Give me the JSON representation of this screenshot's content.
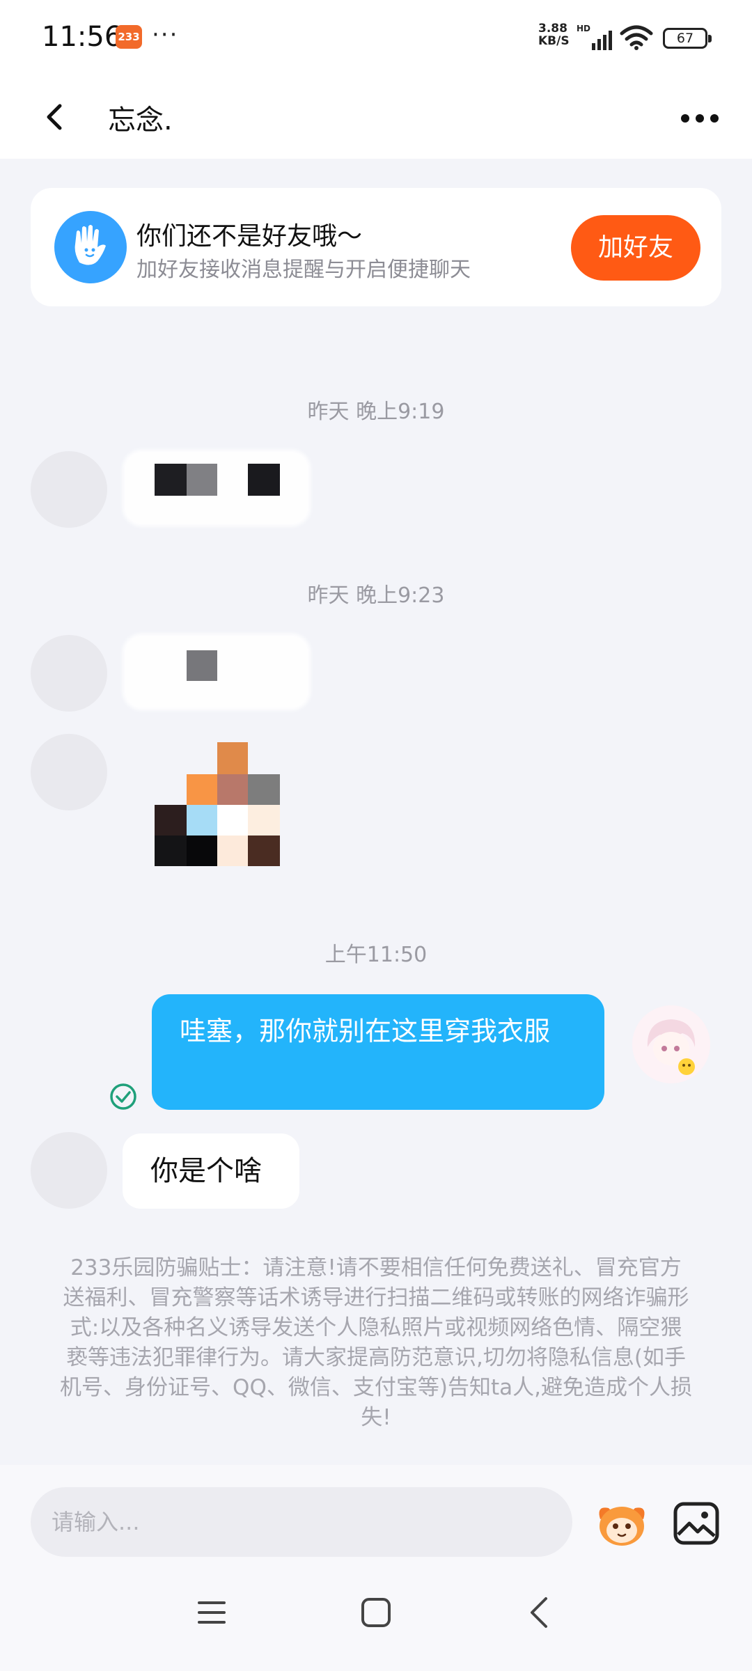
{
  "status_bar": {
    "time": "11:56",
    "app_badge": "233",
    "dots": "···",
    "net_speed_value": "3.88",
    "net_speed_unit": "KB/S",
    "hd": "HD",
    "battery": "67"
  },
  "header": {
    "title": "忘念."
  },
  "friend_banner": {
    "title": "你们还不是好友哦～",
    "subtitle": "加好友接收消息提醒与开启便捷聊天",
    "button_label": "加好友",
    "accent_color": "#ff5a14"
  },
  "messages": {
    "timestamp_1": "昨天 晚上9:19",
    "timestamp_2": "昨天 晚上9:23",
    "timestamp_3": "上午11:50",
    "outgoing_text": "哇塞，那你就别在这里穿我衣服",
    "incoming_text": "你是个啥",
    "outgoing_color": "#23b4fb"
  },
  "safety_tip": "233乐园防骗贴士：请注意!请不要相信任何免费送礼、冒充官方送福利、冒充警察等话术诱导进行扫描二维码或转账的网络诈骗形式:以及各种名义诱导发送个人隐私照片或视频网络色情、隔空猥亵等违法犯罪律行为。请大家提高防范意识,切勿将隐私信息(如手机号、身份证号、QQ、微信、支付宝等)告知ta人,避免造成个人损失!",
  "input_bar": {
    "placeholder": "请输入..."
  },
  "icons": [
    "back-icon",
    "more-icon",
    "hand-wave-icon",
    "read-check-icon",
    "emoji-icon",
    "image-icon",
    "menu-icon",
    "home-icon",
    "nav-back-icon",
    "signal-icon",
    "wifi-icon"
  ]
}
